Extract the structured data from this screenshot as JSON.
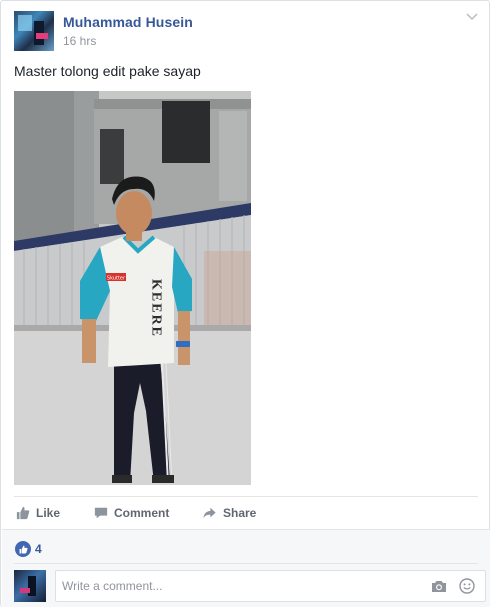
{
  "post": {
    "author": "Muhammad Husein",
    "timestamp": "16 hrs",
    "message": "Master tolong edit pake sayap",
    "photo": {
      "shirt_text": "KEERE",
      "patch_text": "Skutter"
    }
  },
  "actions": {
    "like_label": "Like",
    "comment_label": "Comment",
    "share_label": "Share"
  },
  "reactions": {
    "count": "4"
  },
  "comment_box": {
    "placeholder": "Write a comment..."
  },
  "icons": [
    "chevron-down-icon",
    "like-icon",
    "comment-icon",
    "share-icon",
    "like-badge-icon",
    "camera-icon",
    "smiley-icon"
  ],
  "colors": {
    "author_link": "#365899",
    "like_badge": "#4267b2",
    "action_text": "#616770",
    "meta_text": "#90949c"
  }
}
